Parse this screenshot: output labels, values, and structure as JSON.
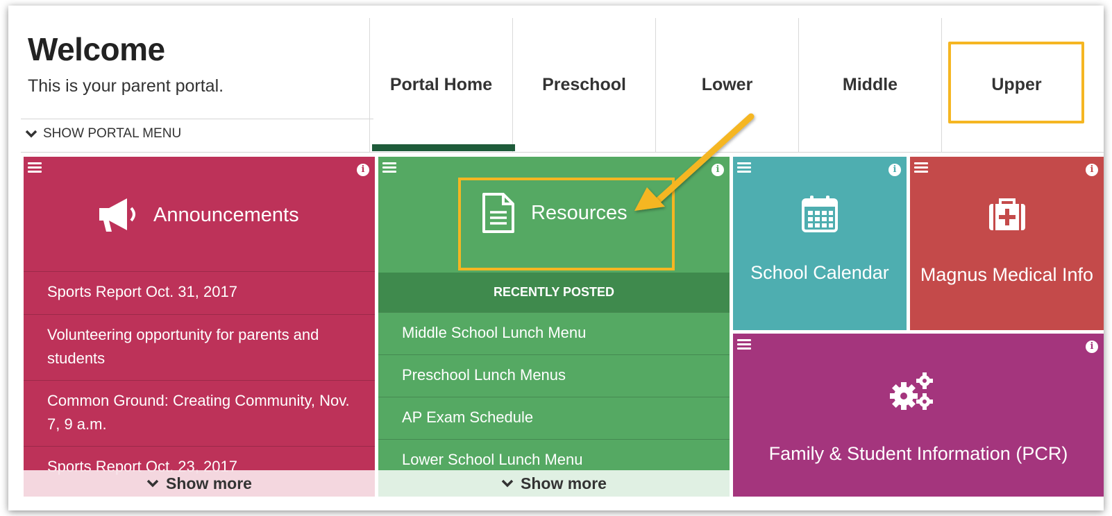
{
  "header": {
    "title": "Welcome",
    "subtitle": "This is your parent portal.",
    "portal_menu_label": "SHOW PORTAL MENU"
  },
  "nav": {
    "tabs": [
      {
        "label": "Portal Home",
        "active": true
      },
      {
        "label": "Preschool",
        "active": false
      },
      {
        "label": "Lower",
        "active": false
      },
      {
        "label": "Middle",
        "active": false
      },
      {
        "label": "Upper",
        "active": false
      }
    ]
  },
  "tiles": {
    "announcements": {
      "title": "Announcements",
      "items": [
        "Sports Report Oct. 31, 2017",
        "Volunteering opportunity for parents and students",
        "Common Ground: Creating Community, Nov. 7, 9 a.m.",
        "Sports Report Oct. 23, 2017"
      ],
      "show_more": "Show more"
    },
    "resources": {
      "title": "Resources",
      "recent_header": "RECENTLY POSTED",
      "items": [
        "Middle School Lunch Menu",
        "Preschool Lunch Menus",
        "AP Exam Schedule",
        "Lower School Lunch Menu"
      ],
      "show_more": "Show more"
    },
    "calendar": {
      "title": "School Calendar"
    },
    "medical": {
      "title": "Magnus Medical Info"
    },
    "family": {
      "title": "Family & Student Information (PCR)"
    }
  },
  "colors": {
    "announcements": "#bd3259",
    "resources": "#55a963",
    "resources_header": "#3f8a4d",
    "calendar": "#4eaeb0",
    "medical": "#c44a4a",
    "family": "#a4357d",
    "highlight": "#f5b622",
    "active_tab": "#1e5b3a"
  }
}
